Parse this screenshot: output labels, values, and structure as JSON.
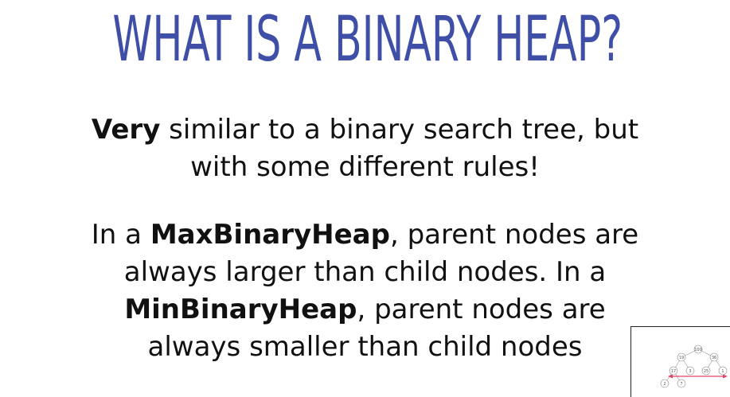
{
  "slide": {
    "title": "WHAT IS A BINARY HEAP?",
    "para1": {
      "bold_lead": "Very",
      "rest_line1": " similar to a binary search tree, but",
      "line2": "with some different rules!"
    },
    "para2": {
      "line1_pre": "In a ",
      "line1_bold": "MaxBinaryHeap",
      "line1_post": ", parent nodes are",
      "line2": "always larger than child nodes. In a",
      "line3_bold": "MinBinaryHeap",
      "line3_post": ", parent nodes are",
      "line4": "always smaller than child nodes"
    }
  },
  "thumbnail": {
    "nodes": [
      "100",
      "19",
      "36",
      "17",
      "3",
      "25",
      "1",
      "2",
      "7"
    ]
  },
  "colors": {
    "title": "#3f4fa8",
    "text": "#111111",
    "arrow": "#e0406a"
  }
}
